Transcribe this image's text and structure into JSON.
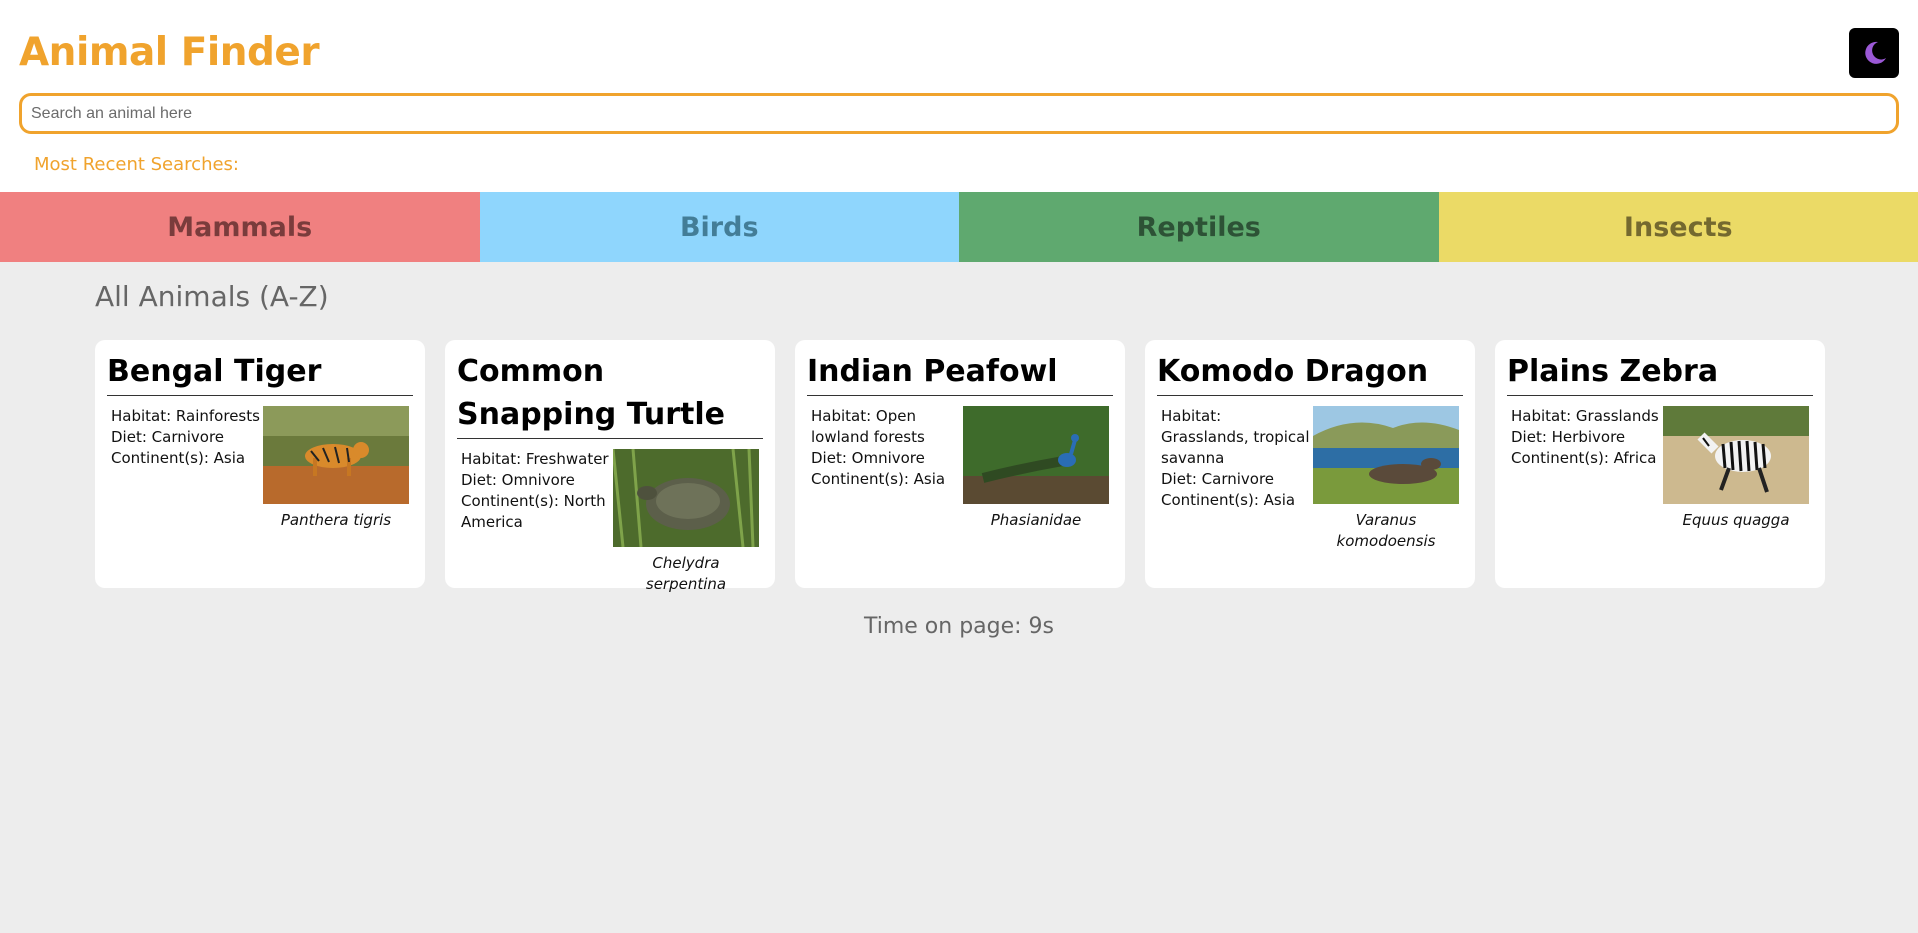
{
  "header": {
    "title": "Animal Finder",
    "theme_toggle_icon": "moon-icon",
    "search_placeholder": "Search an animal here",
    "recent_label": "Most Recent Searches:"
  },
  "categories": [
    {
      "label": "Mammals",
      "color": "#f08080"
    },
    {
      "label": "Birds",
      "color": "#8fd6fd"
    },
    {
      "label": "Reptiles",
      "color": "#5fa96f"
    },
    {
      "label": "Insects",
      "color": "#ebda66"
    }
  ],
  "section_title": "All Animals (A-Z)",
  "animals": [
    {
      "name": "Bengal Tiger",
      "habitat": "Habitat: Rainforests",
      "diet": "Diet: Carnivore",
      "continents": "Continent(s): Asia",
      "scientific": "Panthera tigris"
    },
    {
      "name": "Common Snapping Turtle",
      "habitat": "Habitat: Freshwater",
      "diet": "Diet: Omnivore",
      "continents": "Continent(s): North America",
      "scientific": "Chelydra serpentina"
    },
    {
      "name": "Indian Peafowl",
      "habitat": "Habitat: Open lowland forests",
      "diet": "Diet: Omnivore",
      "continents": "Continent(s): Asia",
      "scientific": "Phasianidae"
    },
    {
      "name": "Komodo Dragon",
      "habitat": "Habitat: Grasslands, tropical savanna",
      "diet": "Diet: Carnivore",
      "continents": "Continent(s): Asia",
      "scientific": "Varanus komodoensis"
    },
    {
      "name": "Plains Zebra",
      "habitat": "Habitat: Grasslands",
      "diet": "Diet: Herbivore",
      "continents": "Continent(s): Africa",
      "scientific": "Equus quagga"
    }
  ],
  "footer": {
    "time_on_page": "Time on page: 9s"
  },
  "colors": {
    "accent": "#f0a32d",
    "page_bg": "#ededed"
  }
}
